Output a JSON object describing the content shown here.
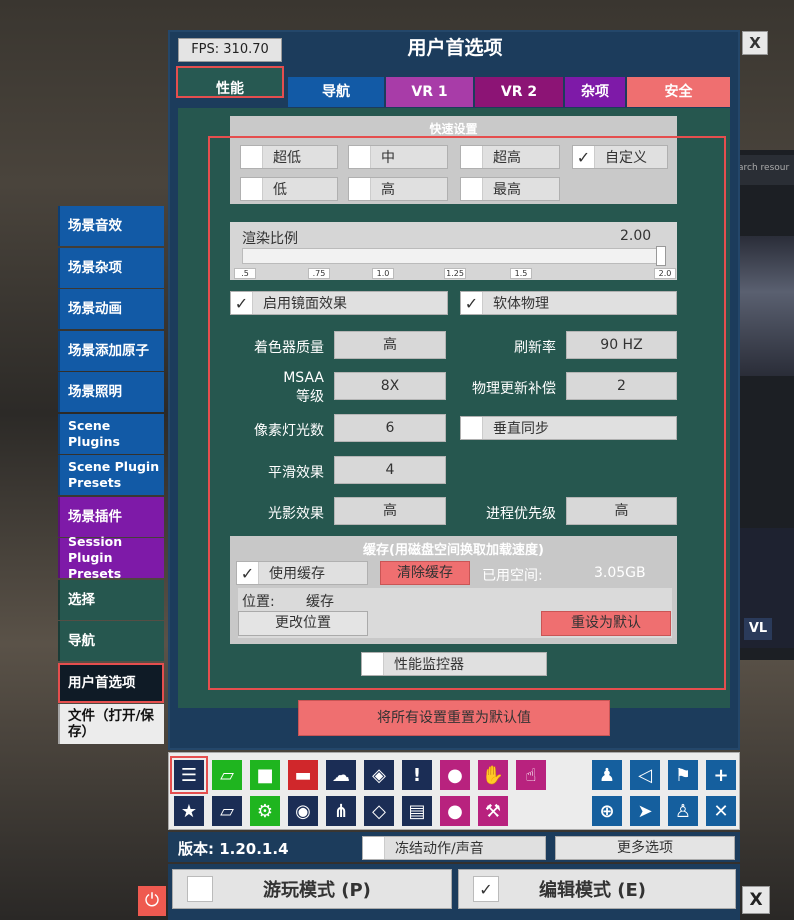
{
  "fps": "FPS: 310.70",
  "title": "用户首选项",
  "close_label": "X",
  "tabs": [
    {
      "label": "性能"
    },
    {
      "label": "导航"
    },
    {
      "label": "VR 1"
    },
    {
      "label": "VR 2"
    },
    {
      "label": "杂项"
    },
    {
      "label": "安全"
    }
  ],
  "sidebar": {
    "items": [
      {
        "label": "场景音效"
      },
      {
        "label": "场景杂项"
      },
      {
        "label": "场景动画"
      },
      {
        "label": "场景添加原子"
      },
      {
        "label": "场景照明"
      },
      {
        "label": "Scene Plugins"
      },
      {
        "label": "Scene Plugin Presets"
      },
      {
        "label": "场景插件"
      },
      {
        "label": "Session Plugin Presets"
      },
      {
        "label": "选择"
      },
      {
        "label": "导航"
      },
      {
        "label": "用户首选项"
      },
      {
        "label": "文件（打开/保存）"
      }
    ]
  },
  "quick": {
    "title": "快速设置",
    "options": [
      {
        "label": "超低",
        "checked": false
      },
      {
        "label": "中",
        "checked": false
      },
      {
        "label": "超高",
        "checked": false
      },
      {
        "label": "自定义",
        "checked": true
      },
      {
        "label": "低",
        "checked": false
      },
      {
        "label": "高",
        "checked": false
      },
      {
        "label": "最高",
        "checked": false
      }
    ]
  },
  "render": {
    "label": "渲染比例",
    "value": "2.00",
    "level": 1.0,
    "ticks": [
      ".5",
      ".75",
      "1.0",
      "1.25",
      "1.5",
      "2.0"
    ]
  },
  "toggles": {
    "mirror": {
      "label": "启用镜面效果",
      "checked": true
    },
    "softbody": {
      "label": "软体物理",
      "checked": true
    },
    "vsync": {
      "label": "垂直同步",
      "checked": false
    }
  },
  "settings": {
    "shader_label": "着色器质量",
    "shader_value": "高",
    "refresh_label": "刷新率",
    "refresh_value": "90 HZ",
    "msaa_label1": "MSAA",
    "msaa_label2": "等级",
    "msaa_value": "8X",
    "physics_label": "物理更新补偿",
    "physics_value": "2",
    "pixel_label": "像素灯光数",
    "pixel_value": "6",
    "smooth_label": "平滑效果",
    "smooth_value": "4",
    "shadow_label": "光影效果",
    "shadow_value": "高",
    "priority_label": "进程优先级",
    "priority_value": "高"
  },
  "cache": {
    "title": "缓存(用磁盘空间换取加载速度)",
    "use_label": "使用缓存",
    "clear_label": "清除缓存",
    "used_label": "已用空间:",
    "used_value": "3.05GB",
    "location_label": "位置:",
    "location_value": "缓存",
    "change_label": "更改位置",
    "reset_label": "重设为默认"
  },
  "perf_monitor_label": "性能监控器",
  "reset_all_label": "将所有设置重置为默认值",
  "toolbar": {
    "icons_row1": [
      "menu-icon",
      "folder-open-icon",
      "folder-icon",
      "folder-save-icon",
      "cloud-download-icon",
      "cube-icon",
      "alert-icon",
      "person-add-icon",
      "hand-icon",
      "pointer-hand-icon"
    ],
    "icons_row2": [
      "star-icon",
      "folder-open-alt-icon",
      "folder-gear-icon",
      "camera-icon",
      "share-node-icon",
      "box-open-icon",
      "document-icon",
      "person-remove-icon",
      "wrench-hand-icon"
    ],
    "icons_right1": [
      "person-icon",
      "unity-icon",
      "flag-icon",
      "plus-icon"
    ],
    "icons_right2": [
      "target-icon",
      "cursor-icon",
      "people-icon",
      "tools-icon"
    ]
  },
  "version": "版本: 1.20.1.4",
  "freeze_label": "冻结动作/声音",
  "more_label": "更多选项",
  "play_mode_label": "游玩模式 (P)",
  "edit_mode_label": "编辑模式 (E)",
  "bg_text": "arch resour"
}
